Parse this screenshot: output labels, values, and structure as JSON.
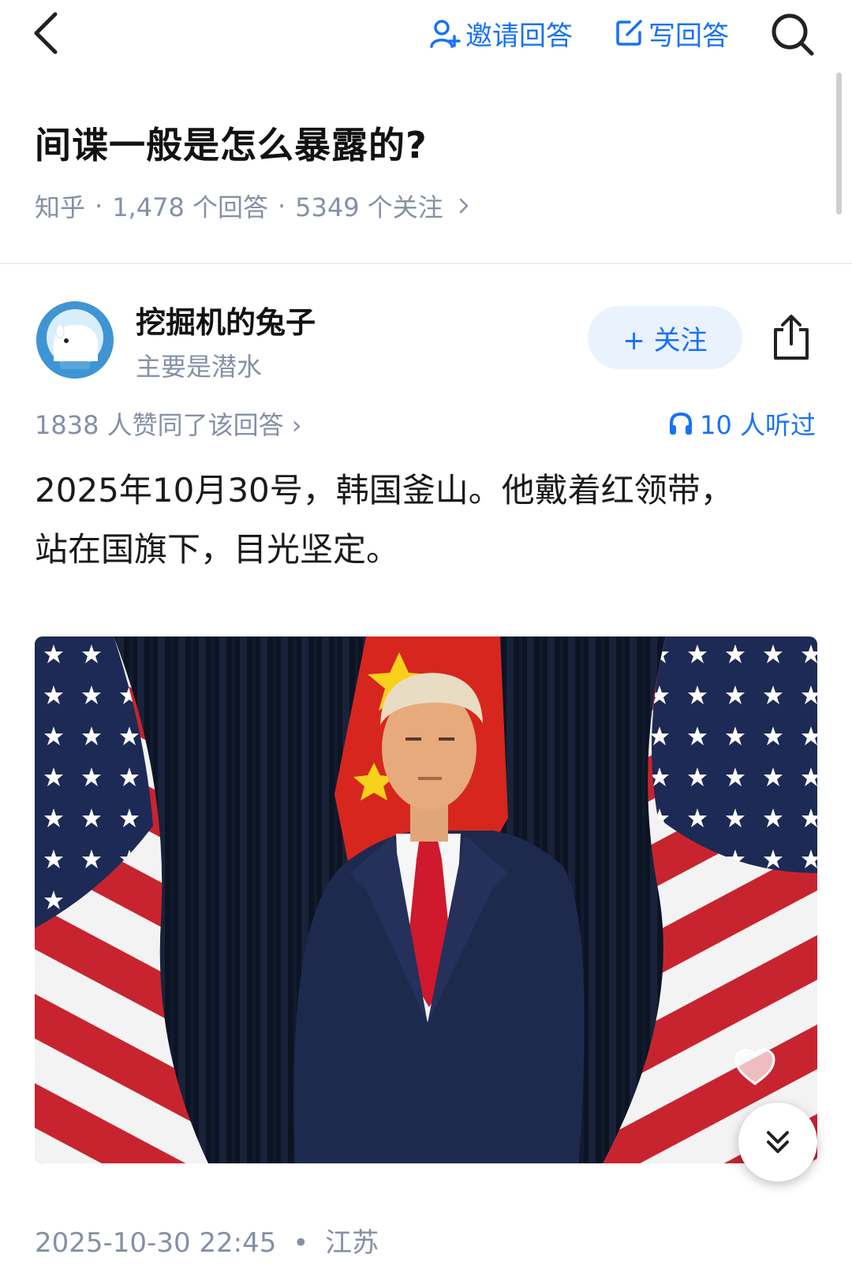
{
  "nav": {
    "invite_label": "邀请回答",
    "write_label": "写回答"
  },
  "question": {
    "title": "间谍一般是怎么暴露的?",
    "source": "知乎",
    "answers": "1,478 个回答",
    "followers": "5349 个关注",
    "separator": "·"
  },
  "answer": {
    "author_name": "挖掘机的兔子",
    "author_bio": "主要是潜水",
    "follow_label": "+ 关注",
    "votes_text": "1838 人赞同了该回答 ›",
    "listened_text": "10 人听过",
    "paragraph_line1": "2025年10月30号，韩国釜山。他戴着红领带，",
    "paragraph_line2": "站在国旗下，目光坚定。",
    "timestamp": "2025-10-30 22:45",
    "location_separator": "•",
    "location": "江苏"
  },
  "colors": {
    "accent": "#1772f6",
    "muted": "#8590a6",
    "title": "#121212"
  },
  "icons": [
    "back-icon",
    "add-user-icon",
    "edit-icon",
    "search-icon",
    "share-icon",
    "headphone-icon",
    "heart-icon",
    "double-chevron-down-icon"
  ]
}
